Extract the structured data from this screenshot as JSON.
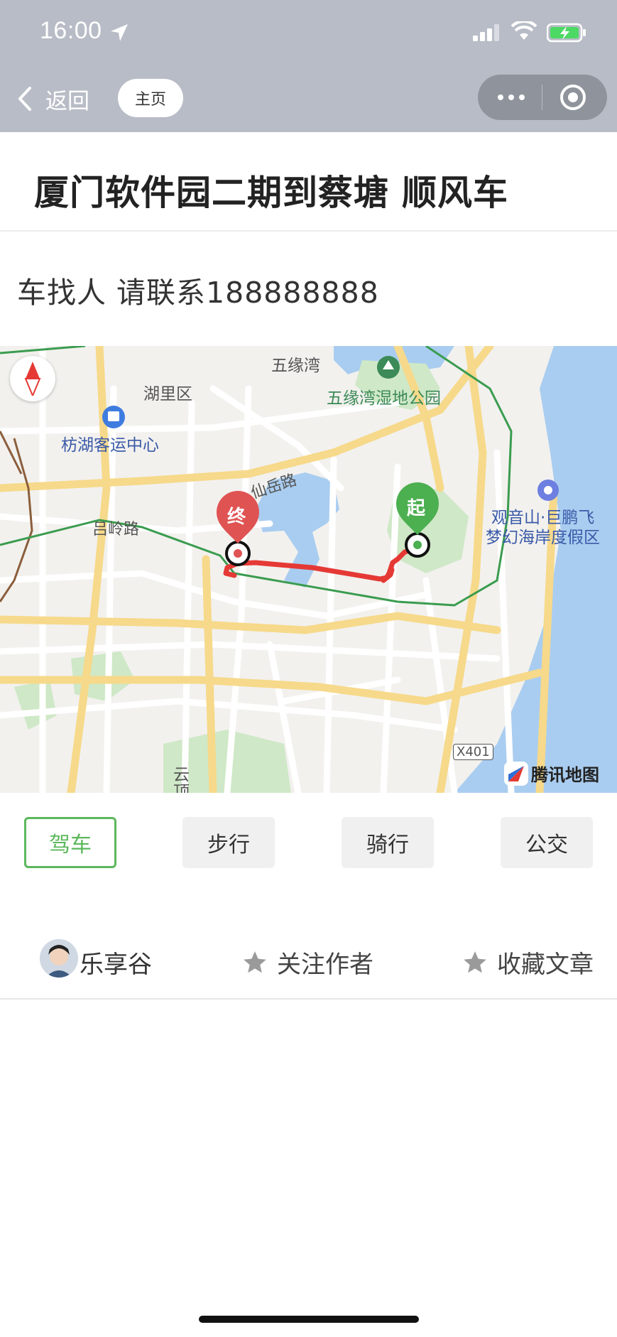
{
  "status_bar": {
    "time": "16:00"
  },
  "nav_bar": {
    "back_label": "返回",
    "home_label": "主页"
  },
  "page": {
    "title": "厦门软件园二期到蔡塘 顺风车",
    "contact_text": "车找人 请联系188888888"
  },
  "map": {
    "labels": {
      "wuyuanwan": "五缘湾",
      "wetland_park": "五缘湾湿地公园",
      "huli_district": "湖里区",
      "bus_center": "枋湖客运中心",
      "xianyue_road": "仙岳路",
      "lvling_road": "吕岭路",
      "resort_line1": "观音山·巨鹏飞",
      "resort_line2": "梦幻海岸度假区",
      "x401": "X401",
      "yun": "云",
      "ding": "顶"
    },
    "start_marker": "起",
    "end_marker": "终",
    "brand": "腾讯地图",
    "colors": {
      "route": "#e53935",
      "start": "#4caf50",
      "end": "#e05353",
      "water": "#a9cdf0"
    }
  },
  "travel_modes": [
    {
      "label": "驾车",
      "active": true
    },
    {
      "label": "步行",
      "active": false
    },
    {
      "label": "骑行",
      "active": false
    },
    {
      "label": "公交",
      "active": false
    }
  ],
  "author_bar": {
    "author_name": "乐享谷",
    "follow_label": "关注作者",
    "collect_label": "收藏文章"
  },
  "accent_color": "#5cb85c"
}
